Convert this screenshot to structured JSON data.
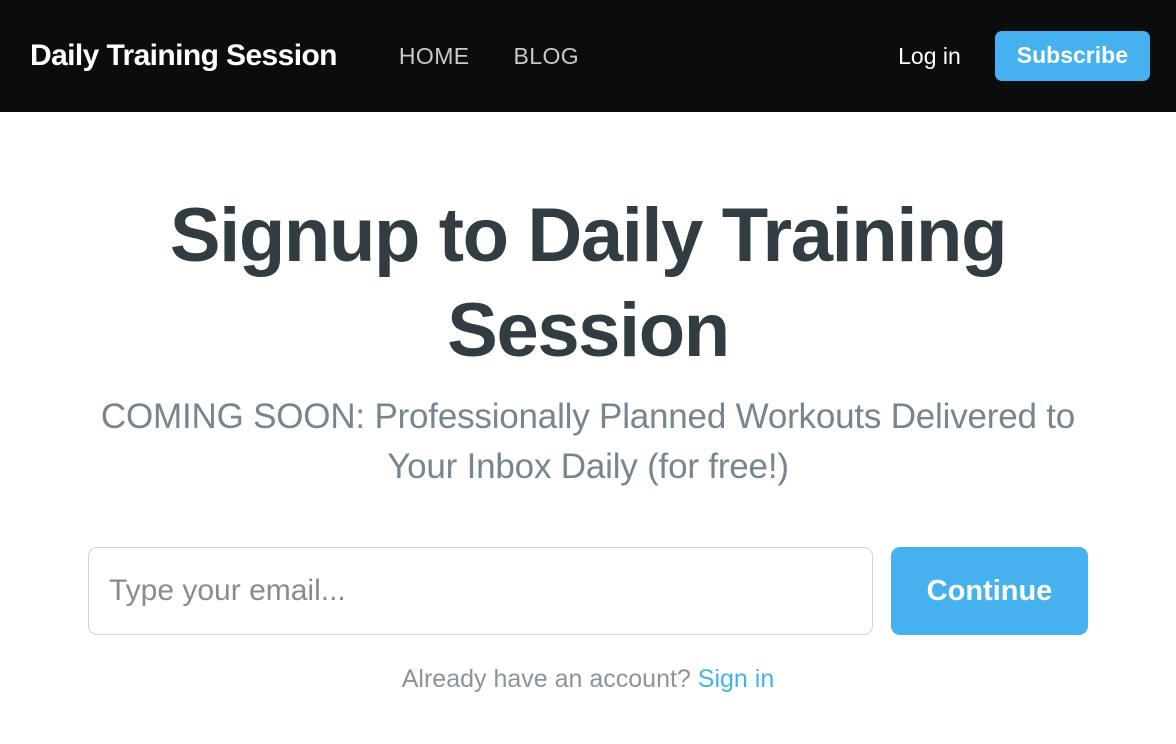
{
  "header": {
    "brand": "Daily Training Session",
    "nav": [
      {
        "label": "HOME"
      },
      {
        "label": "BLOG"
      }
    ],
    "login_label": "Log in",
    "subscribe_label": "Subscribe",
    "background_color": "#0b0c0d",
    "accent_color": "#45b2ef"
  },
  "hero": {
    "title": "Signup to Daily Training Session",
    "subtitle": "COMING SOON: Professionally Planned Workouts Delivered to Your Inbox Daily (for free!)",
    "title_color": "#313c43",
    "subtitle_color": "#76868f"
  },
  "signup": {
    "email_placeholder": "Type your email...",
    "email_value": "",
    "continue_label": "Continue",
    "button_color": "#45b2ef"
  },
  "footer": {
    "signin_prompt": "Already have an account?",
    "signin_link_label": "Sign in",
    "link_color": "#45b2ef"
  }
}
